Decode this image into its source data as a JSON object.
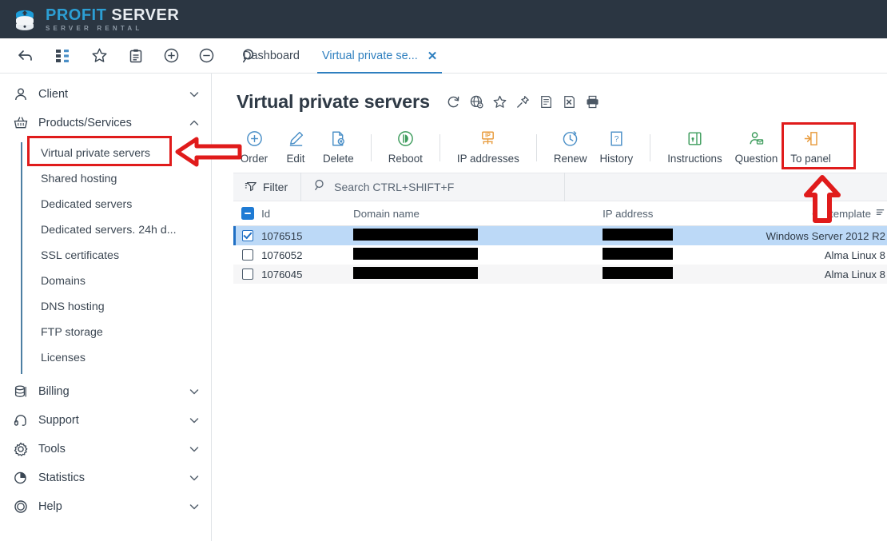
{
  "brand": {
    "name_primary": "PROFIT",
    "name_secondary": "SERVER",
    "tagline": "SERVER RENTAL",
    "logo_icon": "database-logo-icon",
    "bar_color": "#2b3642",
    "accent_color": "#2c9fd4"
  },
  "nav_toolbar": {
    "icons": [
      {
        "name": "back-arrow-icon",
        "glyph": "back"
      },
      {
        "name": "sitemap-tree-icon",
        "glyph": "tree"
      },
      {
        "name": "star-favorite-icon",
        "glyph": "star"
      },
      {
        "name": "clipboard-icon",
        "glyph": "clipboard"
      },
      {
        "name": "plus-circle-icon",
        "glyph": "plus"
      },
      {
        "name": "minus-circle-icon",
        "glyph": "minus"
      },
      {
        "name": "search-icon",
        "glyph": "search"
      }
    ]
  },
  "tabs": [
    {
      "label": "Dashboard",
      "active": false,
      "closable": false
    },
    {
      "label": "Virtual private se...",
      "active": true,
      "closable": true,
      "close_glyph": "✕"
    }
  ],
  "sidebar": {
    "groups": [
      {
        "label": "Client",
        "icon": "user-icon",
        "expanded": false,
        "chevron": "down"
      },
      {
        "label": "Products/Services",
        "icon": "basket-icon",
        "expanded": true,
        "chevron": "up"
      }
    ],
    "sub_items": [
      {
        "label": "Virtual private servers",
        "selected": true
      },
      {
        "label": "Shared hosting",
        "selected": false
      },
      {
        "label": "Dedicated servers",
        "selected": false
      },
      {
        "label": "Dedicated servers. 24h d...",
        "selected": false
      },
      {
        "label": "SSL certificates",
        "selected": false
      },
      {
        "label": "Domains",
        "selected": false
      },
      {
        "label": "DNS hosting",
        "selected": false
      },
      {
        "label": "FTP storage",
        "selected": false
      },
      {
        "label": "Licenses",
        "selected": false
      }
    ],
    "bottom_groups": [
      {
        "label": "Billing",
        "icon": "billing-database-icon",
        "chevron": "down"
      },
      {
        "label": "Support",
        "icon": "headset-icon",
        "chevron": "down"
      },
      {
        "label": "Tools",
        "icon": "gear-icon",
        "chevron": "down"
      },
      {
        "label": "Statistics",
        "icon": "pie-chart-icon",
        "chevron": "down"
      },
      {
        "label": "Help",
        "icon": "help-circle-icon",
        "chevron": "down"
      }
    ]
  },
  "page": {
    "title": "Virtual private servers",
    "title_icons": [
      {
        "name": "refresh-icon"
      },
      {
        "name": "globe-link-icon"
      },
      {
        "name": "star-icon"
      },
      {
        "name": "pin-icon"
      },
      {
        "name": "report-list-icon"
      },
      {
        "name": "export-excel-icon"
      },
      {
        "name": "print-icon"
      }
    ]
  },
  "actions": [
    {
      "label": "Order",
      "icon": "plus-circle-icon",
      "color": "#4a8fc7",
      "sep_after": false
    },
    {
      "label": "Edit",
      "icon": "pencil-icon",
      "color": "#4a8fc7",
      "sep_after": false
    },
    {
      "label": "Delete",
      "icon": "file-delete-icon",
      "color": "#4a8fc7",
      "sep_after": true
    },
    {
      "label": "Reboot",
      "icon": "power-reboot-icon",
      "color": "#3d9c5c",
      "sep_after": true
    },
    {
      "label": "IP addresses",
      "icon": "ip-network-icon",
      "color": "#e89b3c",
      "sep_after": true
    },
    {
      "label": "Renew",
      "icon": "clock-icon",
      "color": "#4a8fc7",
      "sep_after": false
    },
    {
      "label": "History",
      "icon": "question-page-icon",
      "color": "#4a8fc7",
      "sep_after": true
    },
    {
      "label": "Instructions",
      "icon": "instructions-icon",
      "color": "#3d9c5c",
      "sep_after": false
    },
    {
      "label": "Question",
      "icon": "user-mail-icon",
      "color": "#3d9c5c",
      "sep_after": false
    },
    {
      "label": "To panel",
      "icon": "enter-panel-icon",
      "color": "#e89b3c",
      "sep_after": false,
      "highlighted": true
    }
  ],
  "filter_bar": {
    "filter_label": "Filter",
    "filter_icon": "filter-icon",
    "search_icon": "search-icon",
    "search_placeholder": "Search CTRL+SHIFT+F",
    "search_value": ""
  },
  "table": {
    "select_all_state": "indeterminate",
    "columns": [
      {
        "key": "id",
        "label": "Id"
      },
      {
        "key": "domain",
        "label": "Domain name"
      },
      {
        "key": "ip",
        "label": "IP address"
      },
      {
        "key": "os",
        "label": "OS template",
        "sort_icon": "sort-icon"
      }
    ],
    "rows": [
      {
        "checked": true,
        "selected": true,
        "id": "1076515",
        "domain": "",
        "domain_redacted": true,
        "domain_redact_width": 156,
        "ip": "",
        "ip_redacted": true,
        "ip_redact_width": 88,
        "os": "Windows Server 2012 R2"
      },
      {
        "checked": false,
        "selected": false,
        "id": "1076052",
        "domain": "",
        "domain_redacted": true,
        "domain_redact_width": 156,
        "ip": "",
        "ip_redacted": true,
        "ip_redact_width": 88,
        "os": "Alma Linux 8"
      },
      {
        "checked": false,
        "selected": false,
        "id": "1076045",
        "domain": "",
        "domain_redacted": true,
        "domain_redact_width": 156,
        "ip": "",
        "ip_redacted": true,
        "ip_redact_width": 88,
        "os": "Alma Linux 8"
      }
    ]
  },
  "annotations": {
    "color": "#e01b1b",
    "items": [
      {
        "name": "highlight-box-sidebar-vps",
        "type": "box"
      },
      {
        "name": "pointer-arrow-left-sidebar",
        "type": "arrow-left"
      },
      {
        "name": "highlight-box-to-panel",
        "type": "box"
      },
      {
        "name": "pointer-arrow-up-to-panel",
        "type": "arrow-up"
      }
    ]
  }
}
